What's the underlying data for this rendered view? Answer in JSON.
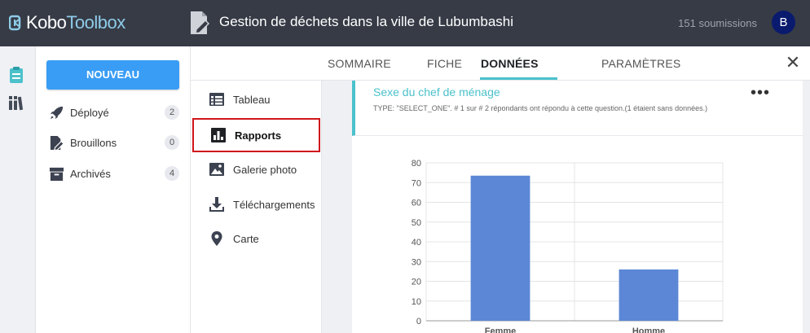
{
  "header": {
    "logo_text_a": "Kobo",
    "logo_text_b": "Toolbox",
    "title": "Gestion de déchets dans la ville de Lubumbashi",
    "submissions": "151 soumissions",
    "avatar_letter": "B"
  },
  "sidebar": {
    "new_button": "NOUVEAU",
    "items": [
      {
        "label": "Déployé",
        "count": "2",
        "icon": "rocket-icon"
      },
      {
        "label": "Brouillons",
        "count": "0",
        "icon": "draft-edit-icon"
      },
      {
        "label": "Archivés",
        "count": "4",
        "icon": "archive-box-icon"
      }
    ]
  },
  "tabs": [
    {
      "label": "SOMMAIRE"
    },
    {
      "label": "FICHE"
    },
    {
      "label": "DONNÉES"
    },
    {
      "label": "PARAMÈTRES"
    }
  ],
  "subnav": [
    {
      "label": "Tableau",
      "icon": "table-icon"
    },
    {
      "label": "Rapports",
      "icon": "bar-chart-icon"
    },
    {
      "label": "Galerie photo",
      "icon": "photo-icon"
    },
    {
      "label": "Téléchargements",
      "icon": "download-icon"
    },
    {
      "label": "Carte",
      "icon": "map-pin-icon"
    }
  ],
  "report": {
    "question_title": "Sexe du chef de ménage",
    "question_meta": "TYPE: \"SELECT_ONE\". # 1 sur # 2 répondants ont répondu à cette question.(1 étaient sans données.)"
  },
  "chart_data": {
    "type": "bar",
    "categories": [
      "Femme",
      "Homme"
    ],
    "values": [
      73.5,
      26
    ],
    "ylim": [
      0,
      80
    ],
    "yticks": [
      0,
      10,
      20,
      30,
      40,
      50,
      60,
      70,
      80
    ],
    "grid": true,
    "title": "",
    "xlabel": "",
    "ylabel": "",
    "bar_color": "#5b87d6"
  },
  "colors": {
    "topbar": "#363b46",
    "accent": "#4bc1cb",
    "primary_button": "#3a9df5",
    "highlight_border": "#d0161c"
  }
}
